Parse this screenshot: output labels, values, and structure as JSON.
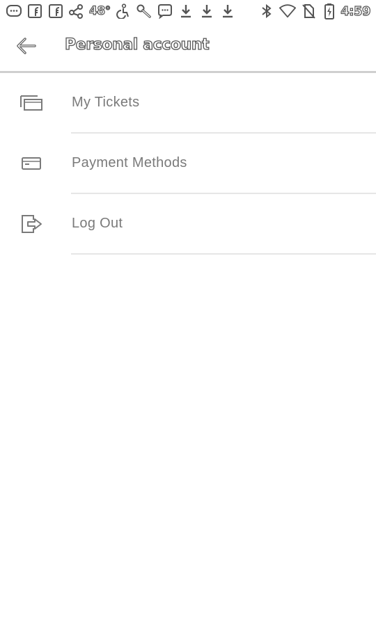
{
  "status_bar": {
    "left_icons": [
      "message-icon",
      "facebook-icon",
      "facebook-icon",
      "share-icon"
    ],
    "temperature": "48°",
    "right_left_icons": [
      "accessibility-icon",
      "wrench-icon",
      "chat-icon",
      "download-icon",
      "download-icon",
      "download-icon"
    ],
    "system_icons": [
      "bluetooth-icon",
      "wifi-icon",
      "no-sim-icon",
      "battery-icon"
    ],
    "time": "4:59"
  },
  "app_bar": {
    "back_icon": "arrow-left-icon",
    "title": "Personal account"
  },
  "menu": {
    "items": [
      {
        "icon": "tickets-icon",
        "label": "My Tickets"
      },
      {
        "icon": "credit-card-icon",
        "label": "Payment Methods"
      },
      {
        "icon": "logout-icon",
        "label": "Log Out"
      }
    ]
  },
  "colors": {
    "background": "#ffffff",
    "label": "#7a7a7a",
    "icon": "#777777",
    "divider": "#e6e6e6",
    "app_bar_border": "#cfcfcf"
  }
}
